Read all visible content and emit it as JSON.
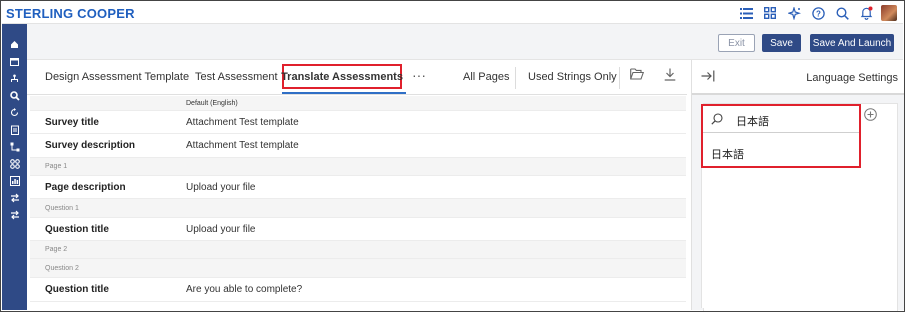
{
  "app": {
    "brand": "STERLING COOPER"
  },
  "topbar": {
    "icons": [
      "list-icon",
      "grid-icon",
      "sparkle-icon",
      "help-icon",
      "search-icon",
      "bell-icon",
      "avatar"
    ]
  },
  "sidebar": {
    "icons": [
      "home-icon",
      "calendar-icon",
      "hierarchy-icon",
      "search-user-icon",
      "refresh-icon",
      "clipboard-icon",
      "tree-icon",
      "apps-icon",
      "report-icon",
      "transfer-icon",
      "swap-icon"
    ]
  },
  "actions": {
    "exit": "Exit",
    "save": "Save",
    "save_launch": "Save And Launch"
  },
  "tabs": {
    "design": "Design Assessment Template",
    "test": "Test Assessment",
    "translate": "Translate Assessments",
    "more": "···",
    "all_pages": "All Pages",
    "used_strings": "Used Strings Only"
  },
  "table": {
    "header": "Default (English)",
    "rows": [
      {
        "type": "data",
        "key": "Survey title",
        "value": "Attachment Test template"
      },
      {
        "type": "data",
        "key": "Survey description",
        "value": "Attachment Test template"
      },
      {
        "type": "section",
        "label": "Page 1"
      },
      {
        "type": "data",
        "key": "Page description",
        "value": "Upload your file"
      },
      {
        "type": "section",
        "label": "Question 1"
      },
      {
        "type": "data",
        "key": "Question title",
        "value": "Upload your file"
      },
      {
        "type": "section",
        "label": "Page 2"
      },
      {
        "type": "section",
        "label": "Question 2"
      },
      {
        "type": "data",
        "key": "Question title",
        "value": "Are you able to complete?"
      }
    ]
  },
  "language_panel": {
    "title": "Language Settings",
    "search_value": "日本語",
    "option": "日本語"
  },
  "colors": {
    "primary": "#2f4a86",
    "brand": "#1f5fbf",
    "highlight": "#e0202c",
    "tab_underline": "#2f6fc6"
  }
}
